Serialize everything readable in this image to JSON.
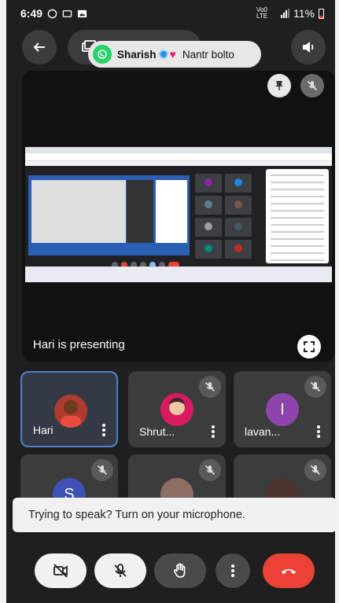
{
  "status_bar": {
    "time": "6:49",
    "network": "Vo0 LTE",
    "battery": "11%"
  },
  "share_pill": {
    "caller_name": "Sharish",
    "message": "Nantr bolto"
  },
  "presentation": {
    "label": "Hari is presenting"
  },
  "participants": [
    {
      "name": "Hari",
      "avatar_letter": "",
      "avatar_color": "#c0392b"
    },
    {
      "name": "Shrut...",
      "avatar_letter": "",
      "avatar_color": "#d81b60"
    },
    {
      "name": "lavan...",
      "avatar_letter": "I",
      "avatar_color": "#8e44ad"
    },
    {
      "name": "",
      "avatar_letter": "S",
      "avatar_color": "#3f51b5"
    },
    {
      "name": "",
      "avatar_letter": "",
      "avatar_color": "#8d6e63"
    },
    {
      "name": "",
      "avatar_letter": "",
      "avatar_color": "#5d4037"
    }
  ],
  "toast": {
    "message": "Trying to speak? Turn on your microphone."
  },
  "colors": {
    "background": "#1f1f1f",
    "tile": "#3c3c3c",
    "end_call": "#ea4335",
    "whatsapp": "#25d366"
  },
  "icons": [
    "back-arrow-icon",
    "screen-share-icon",
    "whatsapp-icon",
    "speaker-icon",
    "pin-icon",
    "mic-off-icon",
    "fullscreen-icon",
    "more-vert-icon",
    "camera-off-icon",
    "raise-hand-icon",
    "end-call-icon"
  ]
}
